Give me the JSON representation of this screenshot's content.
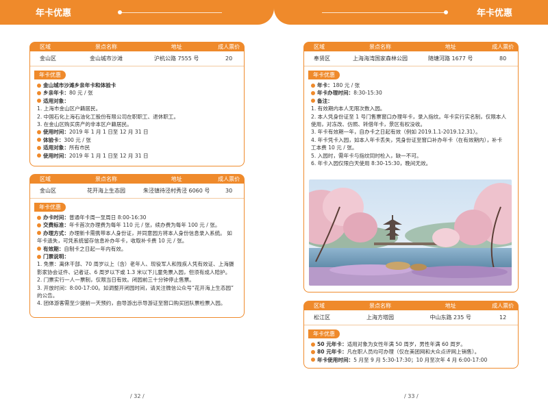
{
  "header": {
    "left_title": "年卡优惠",
    "right_title": "年卡优惠"
  },
  "table_headers": [
    "区域",
    "景点名称",
    "地址",
    "成人票价"
  ],
  "discount_tag": "年卡优惠",
  "card1": {
    "row": [
      "金山区",
      "金山城市沙滩",
      "沪杭公路 7555 号",
      "20"
    ],
    "lines": [
      {
        "bullet": true,
        "bold": true,
        "text": "金山城市沙滩乡亲年卡和体验卡"
      },
      {
        "bullet": true,
        "label": "乡亲年卡：",
        "text": "80 元 / 张"
      },
      {
        "bullet": true,
        "label": "适用对象：",
        "text": ""
      },
      {
        "bullet": false,
        "text": "1. 上海市金山区户籍居民。"
      },
      {
        "bullet": false,
        "text": "2. 中国石化上海石油化工股份有限公司在职职工、退休职工。"
      },
      {
        "bullet": false,
        "text": "3. 在金山区购买房产的非本区户籍居民。"
      },
      {
        "bullet": true,
        "label": "使用时间：",
        "text": "2019 年 1 月 1 日至 12 月 31 日"
      },
      {
        "bullet": true,
        "label": "体验卡：",
        "text": "300 元 / 张"
      },
      {
        "bullet": true,
        "label": "适用对象：",
        "text": "所有市民"
      },
      {
        "bullet": true,
        "label": "使用时间：",
        "text": "2019 年 1 月 1 日至 12 月 31 日"
      }
    ]
  },
  "card2": {
    "row": [
      "金山区",
      "花开海上生态园",
      "朱泾镇待泾村秀泾 6060 号",
      "30"
    ],
    "lines": [
      {
        "bullet": true,
        "label": "办卡时间：",
        "text": "普通年卡周一至周日 8:00-16:30"
      },
      {
        "bullet": true,
        "label": "交费标准：",
        "text": "年卡首次办理费为每年 110 元 / 张，续办费为每年 100 元 / 张。"
      },
      {
        "bullet": true,
        "label": "办理方式：",
        "text": "办理新卡需携带本人身份证，并同意园方将本人身份信息录入系统。 如"
      },
      {
        "bullet": false,
        "text": "年卡遗失，可凭系统留存信息补办年卡，收取补卡费 10 元 / 张。"
      },
      {
        "bullet": true,
        "label": "有效期：",
        "text": "自制卡之日起一年内有效。"
      },
      {
        "bullet": true,
        "label": "门票说明：",
        "text": ""
      },
      {
        "bullet": false,
        "text": "1. 免票：离休干部、70 周岁以上（含）老年人、现役军人和残疾人凭有效证、上海摄"
      },
      {
        "bullet": false,
        "text": "影家协会证件、记者证、6 周岁以下或 1.3 米以下儿童免票入园，但须有成人陪护。"
      },
      {
        "bullet": false,
        "text": "2. 门票实行一人一票制，仅限当日有效。闭园前三十分钟停止售票。"
      },
      {
        "bullet": false,
        "text": "3. 开放时间：8:00-17:00。如调整开闭园时间，请关注微信公众号“花开海上生态园”"
      },
      {
        "bullet": false,
        "text": "的公告。"
      },
      {
        "bullet": false,
        "text": "4. 团体游客需至少提前一天预约，由导游出示导游证至窗口购买团队票检票入园。"
      }
    ]
  },
  "card3": {
    "row": [
      "奉贤区",
      "上海海湾国家森林公园",
      "随塘河路 1677 号",
      "80"
    ],
    "lines": [
      {
        "bullet": true,
        "label": "年卡：",
        "text": "180 元 / 张"
      },
      {
        "bullet": true,
        "label": "年卡办理时间：",
        "text": "8:30-15:30"
      },
      {
        "bullet": true,
        "label": "备注：",
        "text": ""
      },
      {
        "bullet": false,
        "text": "1. 有效期内本人无限次数入园。"
      },
      {
        "bullet": false,
        "text": "2. 本人凭身份证至 1 号门售票窗口办理年卡，录入指纹。年卡实行实名制，仅限本人"
      },
      {
        "bullet": false,
        "text": "使用，对冻改、仿照、转借年卡，景区有权没收。"
      },
      {
        "bullet": false,
        "text": "3. 年卡有效期一年，自办卡之日起有效（例如 2019.1.1-2019.12.31）。"
      },
      {
        "bullet": false,
        "text": "4. 年卡凭卡入园，如本人年卡丢失，凭身份证至窗口补办年卡（在有效期内），补卡"
      },
      {
        "bullet": false,
        "text": "工本费 10 元 / 张。"
      },
      {
        "bullet": false,
        "text": "5. 入园时，需年卡与指纹同时检入，缺一不可。"
      },
      {
        "bullet": false,
        "text": "6. 年卡入园仅限白天使用 8:30-15:30，晚间无效。"
      }
    ]
  },
  "card4": {
    "row": [
      "松江区",
      "上海方塔园",
      "中山东路 235 号",
      "12"
    ],
    "lines": [
      {
        "bullet": true,
        "label": "50 元年卡：",
        "text": "适用对象为女性年满 50 周岁，男性年满 60 周岁。"
      },
      {
        "bullet": true,
        "label": "80 元年卡：",
        "text": "凡在职人员均可办理（仅在美团网和大众点评网上销售）。"
      },
      {
        "bullet": true,
        "label": "年卡使用时间：",
        "text": "5 月至 9 月 5:30-17:30；10 月至次年 4 月 6:00-17:00"
      }
    ]
  },
  "page_numbers": {
    "left": "/ 32 /",
    "right": "/ 33 /"
  }
}
